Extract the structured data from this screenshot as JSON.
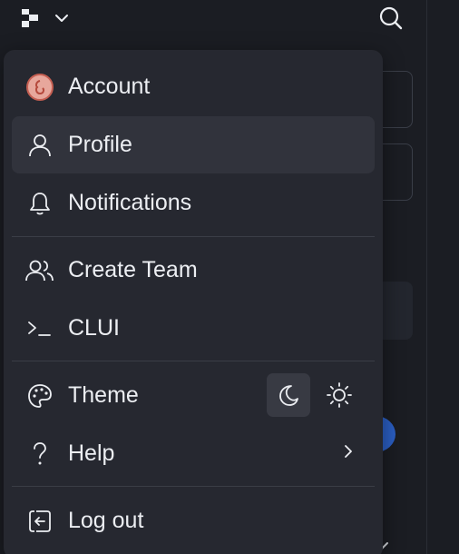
{
  "app": {
    "logo_icon": "workspace-logo-icon",
    "switcher_icon": "chevron-down-icon",
    "search_icon": "search-icon"
  },
  "menu": {
    "account": {
      "label": "Account",
      "icon": "avatar"
    },
    "items": [
      {
        "label": "Profile",
        "icon": "user-icon",
        "highlighted": true
      },
      {
        "label": "Notifications",
        "icon": "bell-icon"
      },
      {
        "label": "Create Team",
        "icon": "users-icon"
      },
      {
        "label": "CLUI",
        "icon": "terminal-icon"
      },
      {
        "label": "Theme",
        "icon": "palette-icon",
        "options": [
          "dark",
          "light"
        ],
        "selected": "dark"
      },
      {
        "label": "Help",
        "icon": "question-icon",
        "has_submenu": true
      },
      {
        "label": "Log out",
        "icon": "logout-icon"
      }
    ]
  },
  "colors": {
    "background": "#1b1d23",
    "menu_background": "#262830",
    "highlight": "#31333c",
    "text": "#eceef2",
    "accent_blue": "#2b5fc4"
  }
}
